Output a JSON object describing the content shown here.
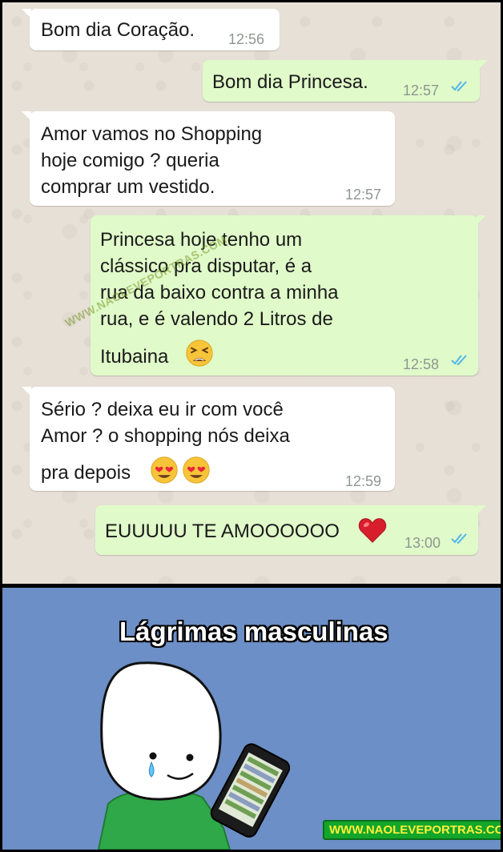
{
  "messages": [
    {
      "direction": "in",
      "lines": [
        "Bom dia Coração."
      ],
      "time": "12:56"
    },
    {
      "direction": "out",
      "lines": [
        "Bom dia Princesa."
      ],
      "time": "12:57",
      "status": "read"
    },
    {
      "direction": "in",
      "lines": [
        "Amor vamos no Shopping",
        "hoje comigo ? queria",
        "comprar um vestido."
      ],
      "time": "12:57"
    },
    {
      "direction": "out",
      "lines": [
        "Princesa hoje tenho um",
        "clássico pra disputar, é a",
        "rua da baixo contra a minha",
        "rua, e é valendo 2 Litros de",
        "Itubaina"
      ],
      "emoji": [
        "tired-face-emoji"
      ],
      "time": "12:58",
      "status": "read"
    },
    {
      "direction": "in",
      "lines": [
        "Sério ? deixa eu ir com você",
        "Amor ? o shopping nós deixa",
        "pra depois"
      ],
      "emoji": [
        "heart-eyes-emoji",
        "heart-eyes-emoji"
      ],
      "time": "12:59"
    },
    {
      "direction": "out",
      "lines": [
        "EUUUUU TE AMOOOOOO"
      ],
      "emoji": [
        "red-heart-emoji"
      ],
      "time": "13:00",
      "status": "read"
    }
  ],
  "watermark": "WWW.NAOLEVEPORTRAS.COM",
  "meme": {
    "caption": "Lágrimas masculinas",
    "footer": "WWW.NAOLEVEPORTRAS.COM"
  },
  "colors": {
    "incoming_bubble": "#ffffff",
    "outgoing_bubble": "#e0fac9",
    "read_ticks": "#4fb6ec",
    "meme_background": "#6b8fc6"
  }
}
